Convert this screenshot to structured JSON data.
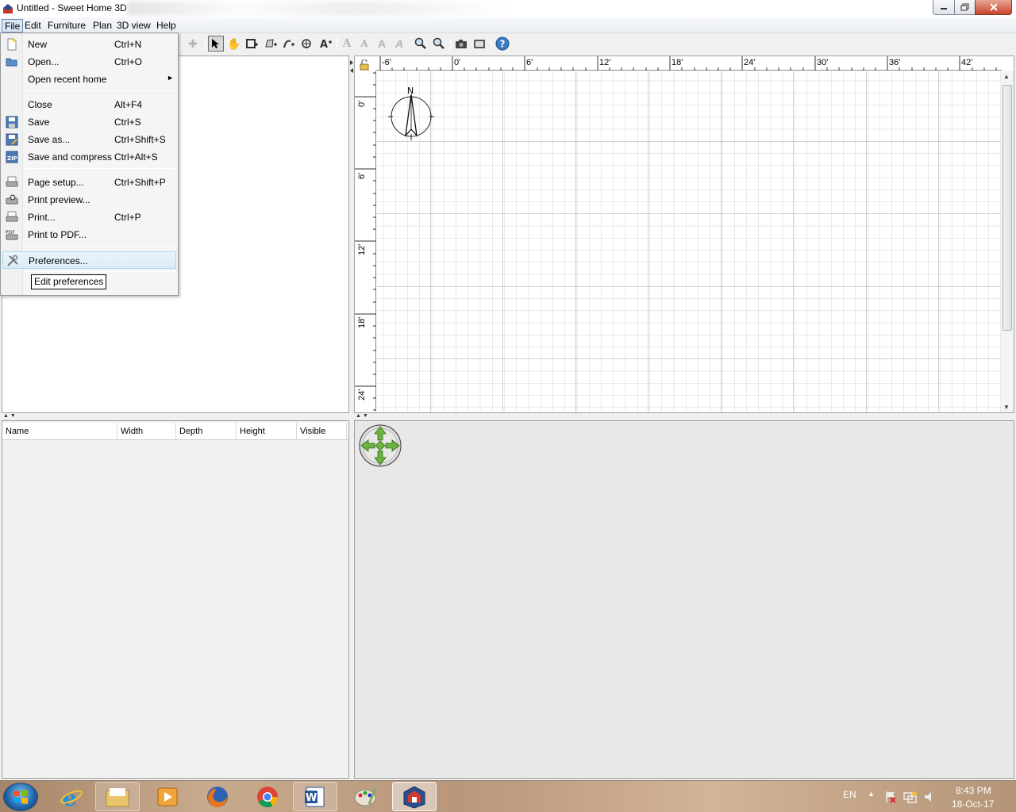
{
  "window": {
    "title": "Untitled - Sweet Home 3D"
  },
  "menubar": {
    "items": [
      {
        "label": "File"
      },
      {
        "label": "Edit"
      },
      {
        "label": "Furniture"
      },
      {
        "label": "Plan"
      },
      {
        "label": "3D view"
      },
      {
        "label": "Help"
      }
    ]
  },
  "file_menu": {
    "items": [
      {
        "label": "New",
        "accel": "Ctrl+N",
        "icon": "new-document-icon"
      },
      {
        "label": "Open...",
        "accel": "Ctrl+O",
        "icon": "open-folder-icon"
      },
      {
        "label": "Open recent home",
        "accel": "",
        "submenu": "►"
      },
      {
        "label": "Close",
        "accel": "Alt+F4"
      },
      {
        "label": "Save",
        "accel": "Ctrl+S",
        "icon": "save-icon"
      },
      {
        "label": "Save as...",
        "accel": "Ctrl+Shift+S",
        "icon": "save-as-icon"
      },
      {
        "label": "Save and compress",
        "accel": "Ctrl+Alt+S",
        "icon": "zip-icon",
        "icon_text": "ZIP"
      },
      {
        "label": "Page setup...",
        "accel": "Ctrl+Shift+P",
        "icon": "page-setup-icon"
      },
      {
        "label": "Print preview...",
        "accel": "",
        "icon": "print-preview-icon"
      },
      {
        "label": "Print...",
        "accel": "Ctrl+P",
        "icon": "printer-icon"
      },
      {
        "label": "Print to PDF...",
        "accel": "",
        "icon": "pdf-icon",
        "icon_text": "PDF"
      },
      {
        "label": "Preferences...",
        "accel": "",
        "icon": "preferences-tools-icon",
        "highlighted": true
      }
    ]
  },
  "tooltip": {
    "text": "Edit preferences"
  },
  "furniture_table": {
    "columns": [
      "Name",
      "Width",
      "Depth",
      "Height",
      "Visible"
    ]
  },
  "plan": {
    "ruler_x": [
      "-6'",
      "0'",
      "6'",
      "12'",
      "18'",
      "24'",
      "30'",
      "36'",
      "42'"
    ],
    "ruler_y": [
      "0'",
      "6'",
      "12'",
      "18'",
      "24'"
    ],
    "compass_label": "N"
  },
  "taskbar": {
    "language": "EN",
    "time": "8:43 PM",
    "date": "18-Oct-17"
  },
  "colors": {
    "menu_highlight": "#d9ecf9",
    "grid_line": "#d4d4d4",
    "grid_major": "#a0a0a0",
    "nav_green": "#6cb33f"
  }
}
